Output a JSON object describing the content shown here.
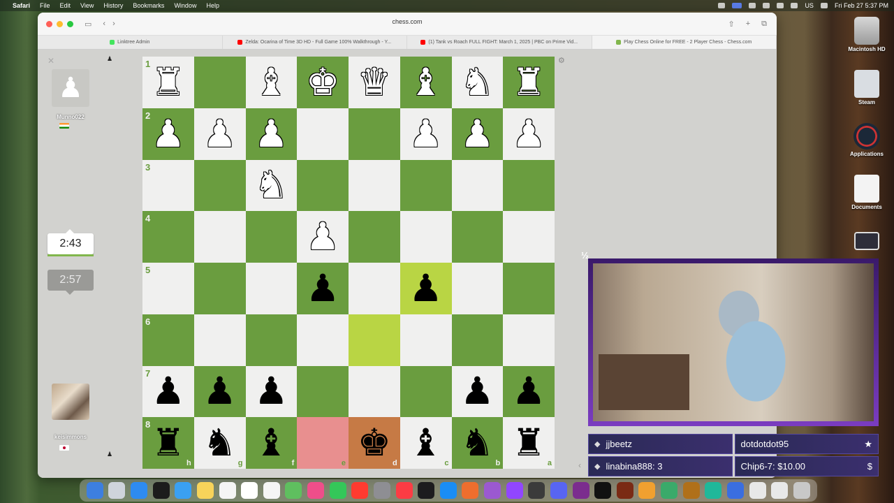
{
  "menubar": {
    "app": "Safari",
    "items": [
      "File",
      "Edit",
      "View",
      "History",
      "Bookmarks",
      "Window",
      "Help"
    ],
    "clock": "Fri Feb 27  5:37 PM",
    "input_source": "US"
  },
  "browser": {
    "url": "chess.com",
    "tabs": [
      {
        "label": "Linktree Admin",
        "color": "#43e55e"
      },
      {
        "label": "Zelda: Ocarina of Time 3D HD - Full Game 100% Walkthrough - Y...",
        "color": "#ff0000"
      },
      {
        "label": "(1) Tank vs Roach FULL FIGHT: March 1, 2025 | PBC on Prime Vid...",
        "color": "#ff0000"
      },
      {
        "label": "Play Chess Online for FREE - 2 Player Chess - Chess.com",
        "color": "#81b64c"
      }
    ]
  },
  "top_player": {
    "name": "Munno022",
    "clock": "2:43"
  },
  "bottom_player": {
    "name": "keisimmons",
    "clock": "2:57"
  },
  "board": {
    "ranks": [
      "1",
      "2",
      "3",
      "4",
      "5",
      "6",
      "7",
      "8"
    ],
    "files": [
      "h",
      "g",
      "f",
      "e",
      "d",
      "c",
      "b",
      "a"
    ],
    "rows": [
      [
        "wR",
        "",
        "wB",
        "wK",
        "wQ",
        "wB",
        "wN",
        "wR"
      ],
      [
        "wP",
        "wP",
        "wP",
        "",
        "",
        "wP",
        "wP",
        "wP"
      ],
      [
        "",
        "",
        "wN",
        "",
        "",
        "",
        "",
        ""
      ],
      [
        "",
        "",
        "",
        "wP",
        "",
        "",
        "",
        ""
      ],
      [
        "",
        "",
        "",
        "bP",
        "",
        "bP",
        "",
        ""
      ],
      [
        "",
        "",
        "",
        "",
        "",
        "",
        "",
        ""
      ],
      [
        "bP",
        "bP",
        "bP",
        "",
        "",
        "",
        "bP",
        "bP"
      ],
      [
        "bR",
        "bN",
        "bB",
        "",
        "bK",
        "bB",
        "bN",
        "bR"
      ]
    ],
    "highlight_squares": [
      "5-5",
      "6-4"
    ],
    "check_square": "8-4",
    "premove_square": "8-3"
  },
  "desktop_icons": [
    {
      "label": "Macintosh HD",
      "icon": "disk-icon"
    },
    {
      "label": "Steam",
      "icon": "steam-icon"
    },
    {
      "label": "Applications",
      "icon": "applications-icon"
    },
    {
      "label": "Documents",
      "icon": "documents-icon"
    }
  ],
  "stream_alerts": {
    "row1": [
      "jjbeetz",
      "dotdotdot95"
    ],
    "row2": [
      "linabina888: 3",
      "Chip6-7: $10.00"
    ]
  },
  "icons": {
    "half_moon": "½"
  }
}
